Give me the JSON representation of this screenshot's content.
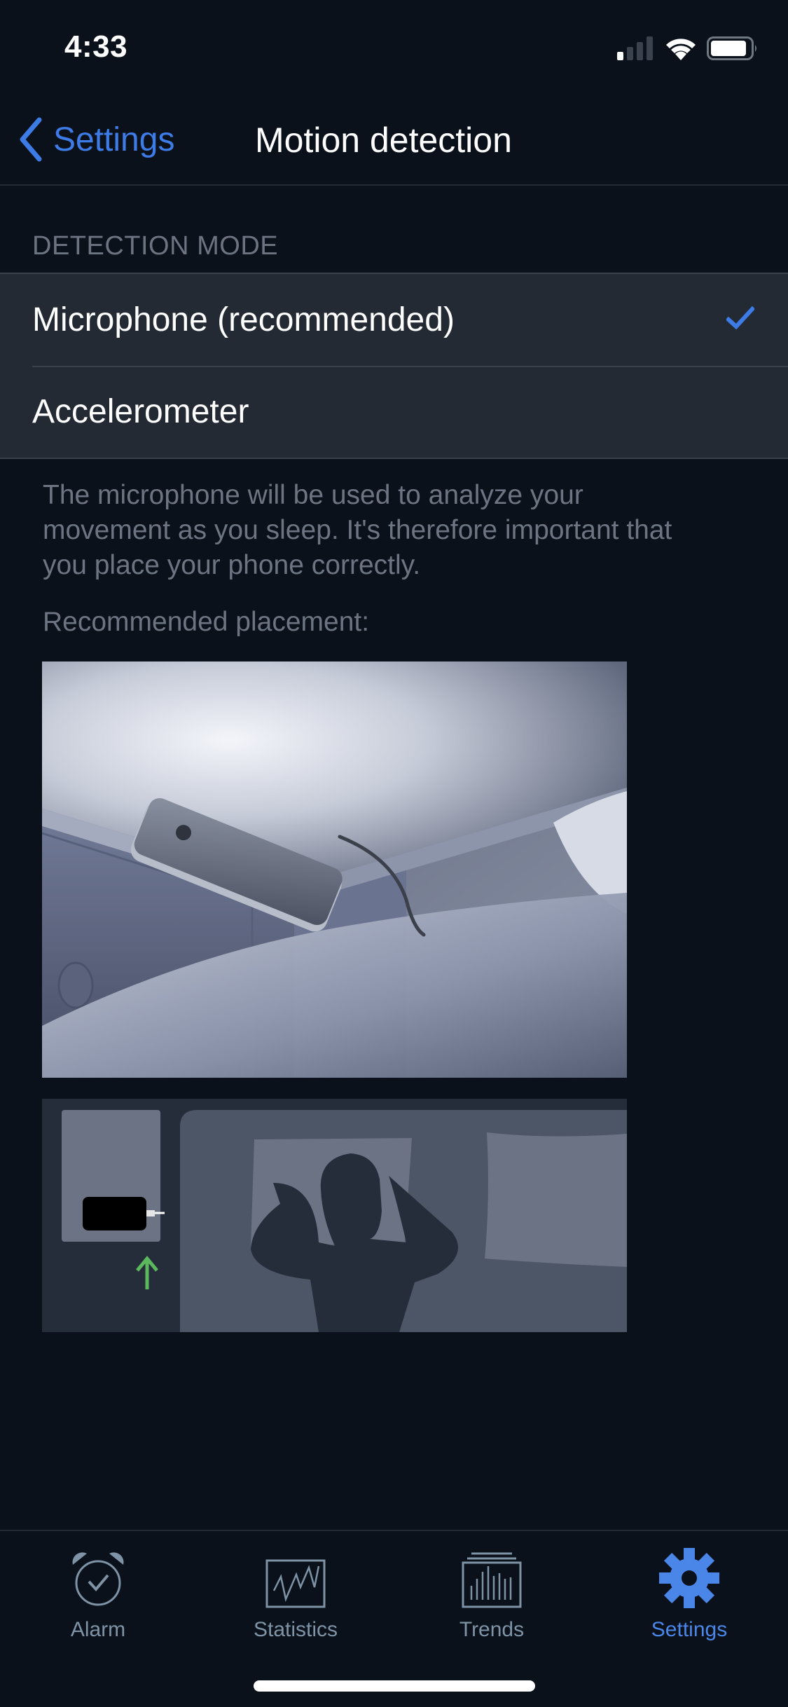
{
  "status_bar": {
    "time": "4:33",
    "icons": [
      "cellular-signal-icon",
      "wifi-icon",
      "battery-icon"
    ],
    "signal_bars_active": 1,
    "signal_bars_total": 4
  },
  "nav": {
    "back_label": "Settings",
    "title": "Motion detection"
  },
  "detection_mode": {
    "header": "DETECTION MODE",
    "options": [
      {
        "label": "Microphone (recommended)",
        "selected": true
      },
      {
        "label": "Accelerometer",
        "selected": false
      }
    ]
  },
  "description": "The microphone will be used to analyze your movement as you sleep. It's therefore important that you place your phone correctly.",
  "placement_label": "Recommended placement:",
  "images": {
    "photo": "phone-on-nightstand-illustration",
    "diagram": "top-down-bed-placement-diagram"
  },
  "tab_bar": {
    "tabs": [
      {
        "label": "Alarm",
        "icon": "alarm-clock-icon",
        "active": false
      },
      {
        "label": "Statistics",
        "icon": "line-chart-icon",
        "active": false
      },
      {
        "label": "Trends",
        "icon": "bar-chart-stack-icon",
        "active": false
      },
      {
        "label": "Settings",
        "icon": "gear-icon",
        "active": true
      }
    ]
  },
  "colors": {
    "background": "#0a111b",
    "row_background": "#232a34",
    "accent": "#3d7ce6",
    "secondary_text": "#6c7581",
    "tab_inactive": "#7f93a6",
    "arrow_green": "#5cb85c"
  }
}
